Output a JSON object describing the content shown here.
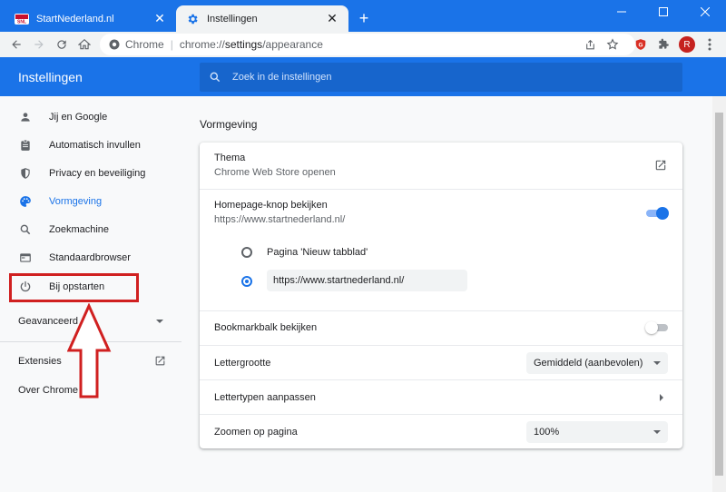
{
  "browser": {
    "tabs": [
      {
        "title": "StartNederland.nl",
        "favicon": "startnederland-logo",
        "active": false
      },
      {
        "title": "Instellingen",
        "favicon": "gear-icon",
        "active": true
      }
    ],
    "new_tab_label": "+",
    "omnibox": {
      "site_label": "Chrome",
      "url_scheme": "chrome://",
      "url_host": "settings",
      "url_path": "/appearance"
    },
    "profile_initial": "R"
  },
  "settings": {
    "title": "Instellingen",
    "search_placeholder": "Zoek in de instellingen"
  },
  "sidebar": {
    "items": [
      {
        "label": "Jij en Google",
        "icon": "person-icon",
        "active": false
      },
      {
        "label": "Automatisch invullen",
        "icon": "clipboard-icon",
        "active": false
      },
      {
        "label": "Privacy en beveiliging",
        "icon": "shield-icon",
        "active": false
      },
      {
        "label": "Vormgeving",
        "icon": "palette-icon",
        "active": true
      },
      {
        "label": "Zoekmachine",
        "icon": "search-icon",
        "active": false
      },
      {
        "label": "Standaardbrowser",
        "icon": "browser-icon",
        "active": false
      },
      {
        "label": "Bij opstarten",
        "icon": "power-icon",
        "active": false
      }
    ],
    "advanced": "Geavanceerd",
    "extensions": "Extensies",
    "about": "Over Chrome"
  },
  "main": {
    "section_title": "Vormgeving",
    "theme": {
      "label": "Thema",
      "sub": "Chrome Web Store openen"
    },
    "homepage": {
      "label": "Homepage-knop bekijken",
      "sub": "https://www.startnederland.nl/",
      "enabled": true
    },
    "homepage_options": {
      "new_tab": "Pagina 'Nieuw tabblad'",
      "custom_url": "https://www.startnederland.nl/",
      "selected": "custom"
    },
    "bookmarks_bar": {
      "label": "Bookmarkbalk bekijken",
      "enabled": false
    },
    "font_size": {
      "label": "Lettergrootte",
      "value": "Gemiddeld (aanbevolen)"
    },
    "fonts": {
      "label": "Lettertypen aanpassen"
    },
    "zoom": {
      "label": "Zoomen op pagina",
      "value": "100%"
    }
  },
  "colors": {
    "accent": "#1a73e8",
    "annotation": "#d02020"
  }
}
